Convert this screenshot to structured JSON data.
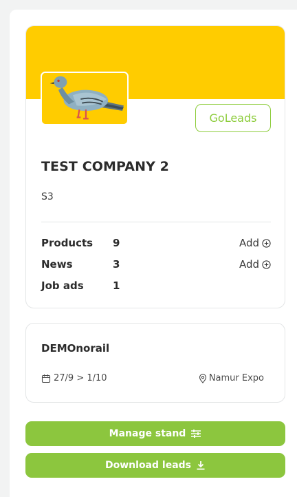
{
  "exhibitor": {
    "badge_label": "GoLeads",
    "company_name": "TEST COMPANY 2",
    "stand_code": "S3",
    "stats": [
      {
        "label": "Products",
        "count": "9",
        "add_label": "Add"
      },
      {
        "label": "News",
        "count": "3",
        "add_label": "Add"
      },
      {
        "label": "Job ads",
        "count": "1"
      }
    ]
  },
  "event": {
    "name": "DEMOnorail",
    "dates": "27/9 > 1/10",
    "location": "Namur Expo"
  },
  "actions": {
    "manage_label": "Manage stand",
    "download_label": "Download leads"
  },
  "icons": {
    "logo": "pigeon-logo-icon",
    "add": "plus-circle-icon",
    "calendar": "calendar-icon",
    "location": "map-pin-icon",
    "manage": "sliders-icon",
    "download": "download-icon"
  },
  "colors": {
    "banner": "#ffcc00",
    "accent_green": "#8cc63e",
    "badge_green": "#8ccc3a",
    "page_background": "#f2f3f3"
  }
}
